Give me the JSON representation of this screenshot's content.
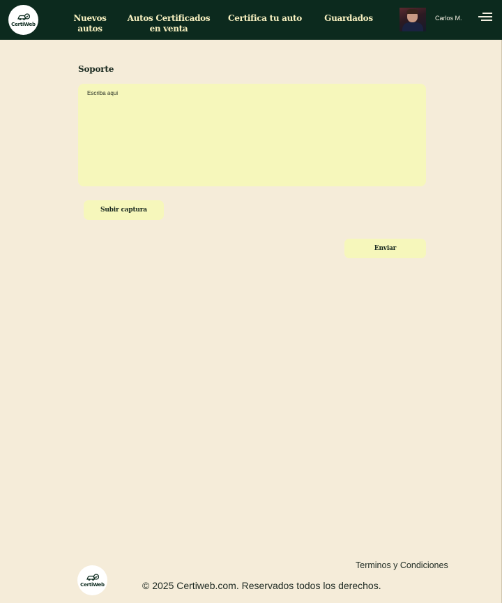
{
  "header": {
    "logo_text": "CertiWeb",
    "nav": [
      {
        "label": "Nuevos autos"
      },
      {
        "label": "Autos Certificados en venta"
      },
      {
        "label": "Certifica tu auto"
      },
      {
        "label": "Guardados"
      }
    ],
    "user_name": "Carlos M."
  },
  "support": {
    "title": "Soporte",
    "textarea_placeholder": "Escriba aqui",
    "upload_label": "Subir captura",
    "send_label": "Enviar"
  },
  "footer": {
    "logo_text": "CertiWeb",
    "terms_label": "Terminos y Condiciones",
    "copyright": "© 2025 Certiweb.com. Reservados todos los derechos."
  },
  "colors": {
    "header_bg": "#0c2a1e",
    "page_bg": "#f5ecd9",
    "accent_yellow": "#f6f7bb"
  }
}
